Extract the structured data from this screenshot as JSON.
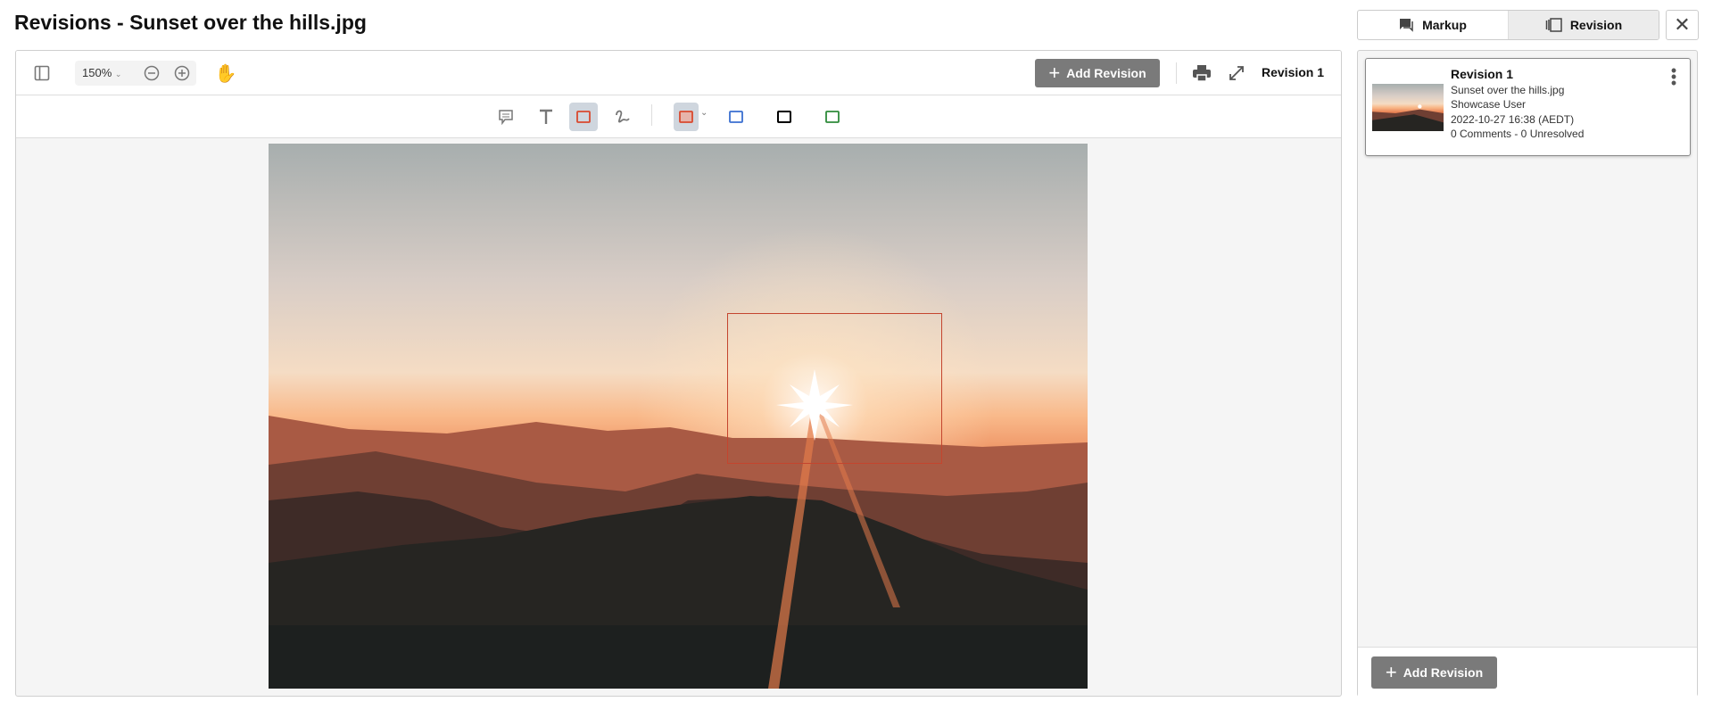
{
  "title": "Revisions - Sunset over the hills.jpg",
  "toolbar": {
    "zoom": "150%",
    "add_revision": "Add Revision",
    "current_revision": "Revision 1"
  },
  "annotation_tools": [
    "comment",
    "text",
    "rectangle",
    "freehand"
  ],
  "colors": {
    "selected": "#d9492f",
    "blue": "#3a6fd0",
    "black": "#000000",
    "green": "#2e8b3a",
    "accent_button": "#7a7a7a"
  },
  "tabs": {
    "markup": "Markup",
    "revision": "Revision",
    "active": "Revision"
  },
  "revisions": [
    {
      "title": "Revision 1",
      "file": "Sunset over the hills.jpg",
      "user": "Showcase User",
      "date": "2022-10-27 16:38 (AEDT)",
      "status": "0 Comments - 0 Unresolved"
    }
  ],
  "sidebar": {
    "add_revision": "Add Revision"
  }
}
